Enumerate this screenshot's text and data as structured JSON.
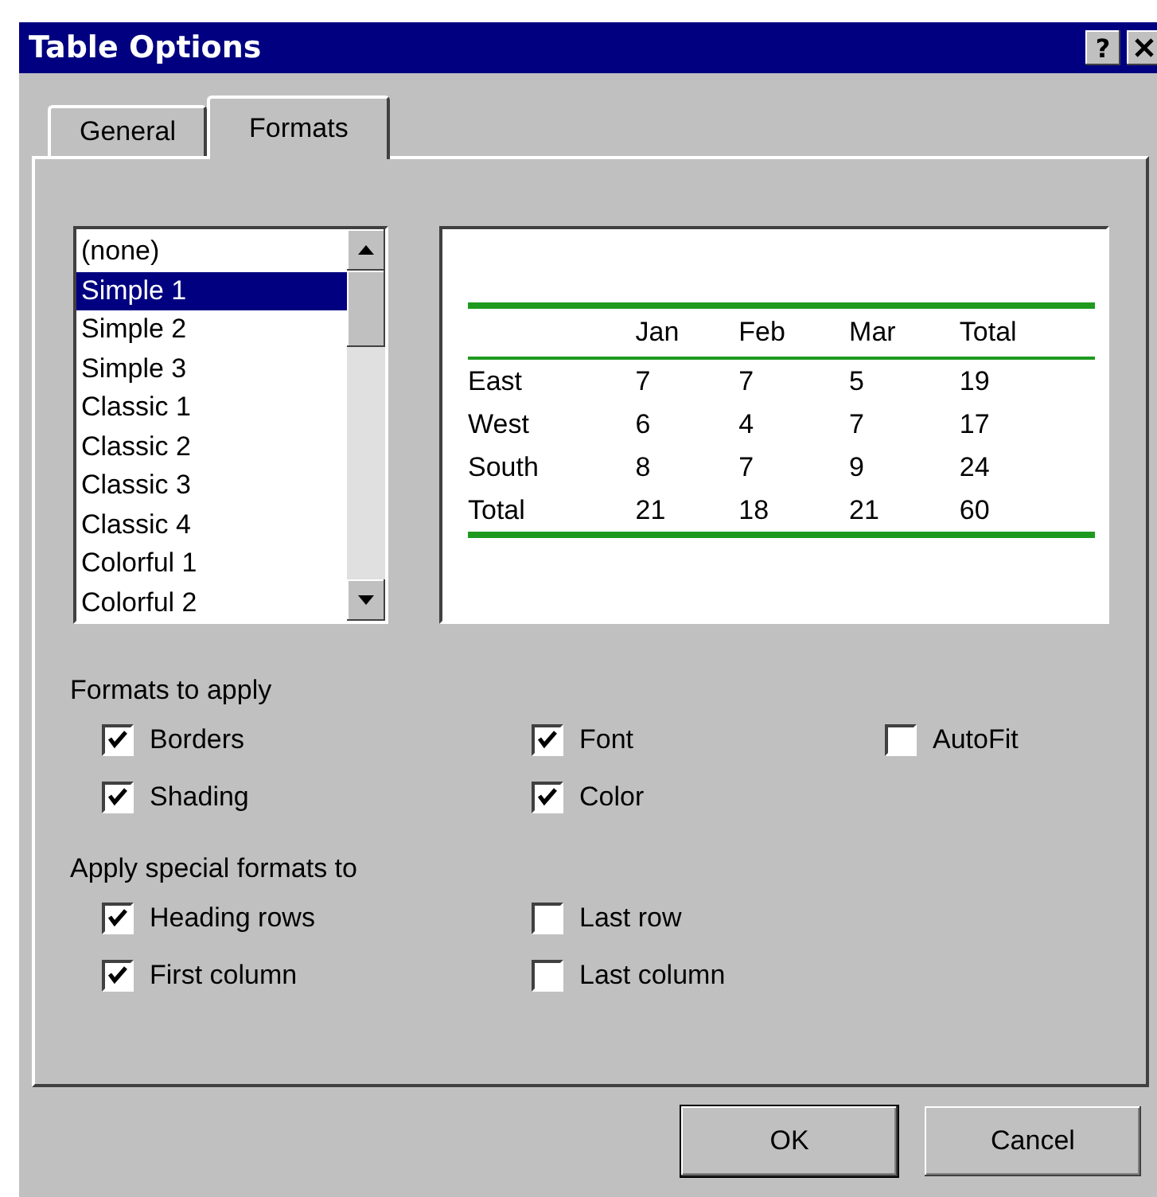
{
  "window": {
    "title": "Table Options",
    "help_button": "?"
  },
  "tabs": [
    {
      "label": "General",
      "selected": false
    },
    {
      "label": "Formats",
      "selected": true
    }
  ],
  "formats_list": {
    "items": [
      {
        "label": "(none)",
        "selected": false
      },
      {
        "label": "Simple 1",
        "selected": true
      },
      {
        "label": "Simple 2",
        "selected": false
      },
      {
        "label": "Simple 3",
        "selected": false
      },
      {
        "label": "Classic 1",
        "selected": false
      },
      {
        "label": "Classic 2",
        "selected": false
      },
      {
        "label": "Classic 3",
        "selected": false
      },
      {
        "label": "Classic 4",
        "selected": false
      },
      {
        "label": "Colorful 1",
        "selected": false
      },
      {
        "label": "Colorful 2",
        "selected": false
      }
    ]
  },
  "preview": {
    "columns": [
      "",
      "Jan",
      "Feb",
      "Mar",
      "Total"
    ],
    "rows": [
      [
        "East",
        "7",
        "7",
        "5",
        "19"
      ],
      [
        "West",
        "6",
        "4",
        "7",
        "17"
      ],
      [
        "South",
        "8",
        "7",
        "9",
        "24"
      ],
      [
        "Total",
        "21",
        "18",
        "21",
        "60"
      ]
    ]
  },
  "formats_to_apply": {
    "label": "Formats to apply",
    "rows": [
      [
        {
          "label": "Borders",
          "checked": true
        },
        {
          "label": "Font",
          "checked": true
        },
        {
          "label": "AutoFit",
          "checked": false
        }
      ],
      [
        {
          "label": "Shading",
          "checked": true
        },
        {
          "label": "Color",
          "checked": true
        }
      ]
    ]
  },
  "special_formats": {
    "label": "Apply special formats to",
    "rows": [
      [
        {
          "label": "Heading rows",
          "checked": true
        },
        {
          "label": "Last row",
          "checked": false
        }
      ],
      [
        {
          "label": "First column",
          "checked": true
        },
        {
          "label": "Last column",
          "checked": false
        }
      ]
    ]
  },
  "buttons": [
    {
      "label": "OK",
      "default": true
    },
    {
      "label": "Cancel",
      "default": false
    }
  ]
}
